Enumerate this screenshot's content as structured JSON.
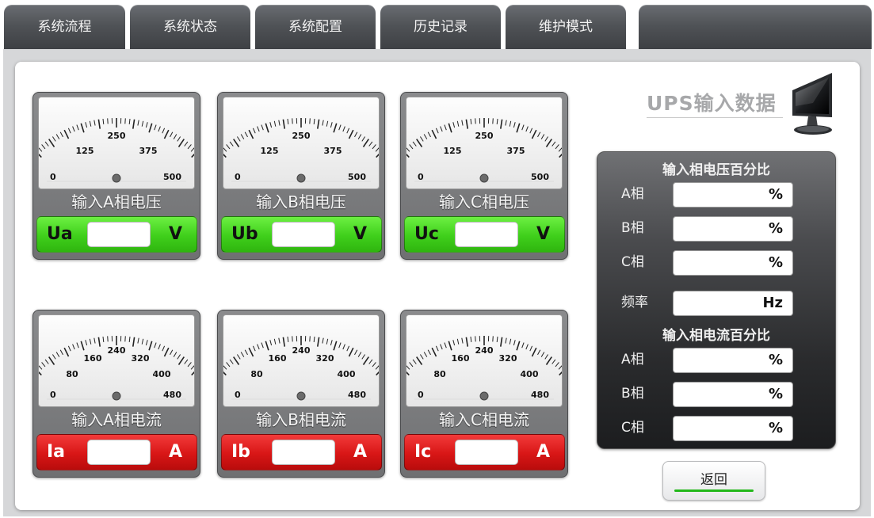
{
  "tabs": [
    {
      "label": "系统流程"
    },
    {
      "label": "系统状态"
    },
    {
      "label": "系统配置"
    },
    {
      "label": "历史记录"
    },
    {
      "label": "维护模式"
    }
  ],
  "voltage_meters": [
    {
      "title": "输入A相电压",
      "symbol": "Ua",
      "unit": "V",
      "value": "",
      "scale": [
        "0",
        "125",
        "250",
        "375",
        "500"
      ]
    },
    {
      "title": "输入B相电压",
      "symbol": "Ub",
      "unit": "V",
      "value": "",
      "scale": [
        "0",
        "125",
        "250",
        "375",
        "500"
      ]
    },
    {
      "title": "输入C相电压",
      "symbol": "Uc",
      "unit": "V",
      "value": "",
      "scale": [
        "0",
        "125",
        "250",
        "375",
        "500"
      ]
    }
  ],
  "current_meters": [
    {
      "title": "输入A相电流",
      "symbol": "Ia",
      "unit": "A",
      "value": "",
      "scale": [
        "0",
        "80",
        "160",
        "240",
        "320",
        "400",
        "480"
      ]
    },
    {
      "title": "输入B相电流",
      "symbol": "Ib",
      "unit": "A",
      "value": "",
      "scale": [
        "0",
        "80",
        "160",
        "240",
        "320",
        "400",
        "480"
      ]
    },
    {
      "title": "输入C相电流",
      "symbol": "Ic",
      "unit": "A",
      "value": "",
      "scale": [
        "0",
        "80",
        "160",
        "240",
        "320",
        "400",
        "480"
      ]
    }
  ],
  "ups_title": "UPS输入数据",
  "voltage_percent": {
    "header": "输入相电压百分比",
    "rows": [
      {
        "label": "A相",
        "unit": "%",
        "value": ""
      },
      {
        "label": "B相",
        "unit": "%",
        "value": ""
      },
      {
        "label": "C相",
        "unit": "%",
        "value": ""
      }
    ]
  },
  "frequency": {
    "label": "频率",
    "unit": "Hz",
    "value": ""
  },
  "current_percent": {
    "header": "输入相电流百分比",
    "rows": [
      {
        "label": "A相",
        "unit": "%",
        "value": ""
      },
      {
        "label": "B相",
        "unit": "%",
        "value": ""
      },
      {
        "label": "C相",
        "unit": "%",
        "value": ""
      }
    ]
  },
  "return_button": "返回",
  "colors": {
    "voltage_readout": "#3fcf1b",
    "current_readout": "#d81616",
    "return_accent": "#22b81a"
  }
}
